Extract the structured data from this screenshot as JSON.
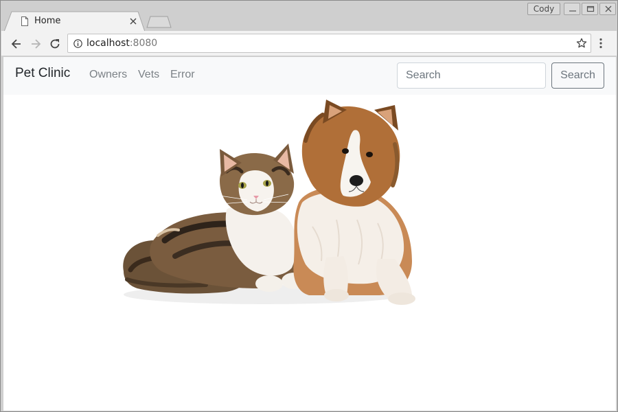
{
  "os": {
    "user_name": "Cody"
  },
  "browser": {
    "tab_title": "Home",
    "url_host": "localhost",
    "url_port": ":8080"
  },
  "navbar": {
    "brand": "Pet Clinic",
    "links": [
      "Owners",
      "Vets",
      "Error"
    ],
    "search_placeholder": "Search",
    "search_button_label": "Search"
  },
  "content": {
    "hero_image": "cat-and-dog-image"
  },
  "colors": {
    "navbar_bg": "#f8f9fa",
    "link": "#7b8186",
    "button_outline": "#6c757d"
  }
}
